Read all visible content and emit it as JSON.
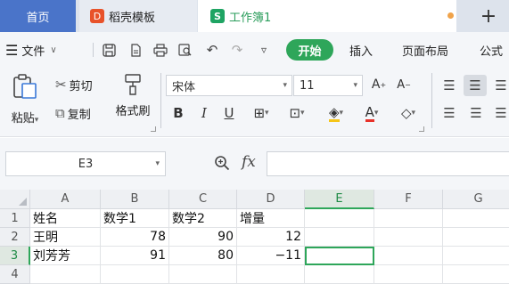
{
  "tabs": {
    "home": "首页",
    "template": "稻壳模板",
    "workbook": "工作簿1",
    "template_icon": "D",
    "workbook_icon": "S",
    "new_tab_icon": "+"
  },
  "menu": {
    "file": "文件",
    "start": "开始",
    "insert": "插入",
    "page_layout": "页面布局",
    "formula": "公式"
  },
  "ribbon": {
    "paste": "粘贴",
    "cut": "剪切",
    "copy": "复制",
    "format_painter": "格式刷",
    "font_name": "宋体",
    "font_size": "11",
    "bold": "B",
    "italic": "I",
    "underline": "U",
    "font_color_letter": "A"
  },
  "formula_bar": {
    "cell_ref": "E3",
    "fx": "fx",
    "content": ""
  },
  "sheet": {
    "columns": [
      "A",
      "B",
      "C",
      "D",
      "E",
      "F",
      "G"
    ],
    "rows": [
      "1",
      "2",
      "3",
      "4"
    ],
    "cells": [
      [
        "姓名",
        "数学1",
        "数学2",
        "增量",
        "",
        "",
        ""
      ],
      [
        "王明",
        "78",
        "90",
        "12",
        "",
        "",
        ""
      ],
      [
        "刘芳芳",
        "91",
        "80",
        "−11",
        "",
        "",
        ""
      ],
      [
        "",
        "",
        "",
        "",
        "",
        "",
        ""
      ]
    ],
    "active_cell": "E3"
  },
  "colors": {
    "accent_green": "#2ea65a",
    "home_tab_blue": "#4a74c9"
  }
}
